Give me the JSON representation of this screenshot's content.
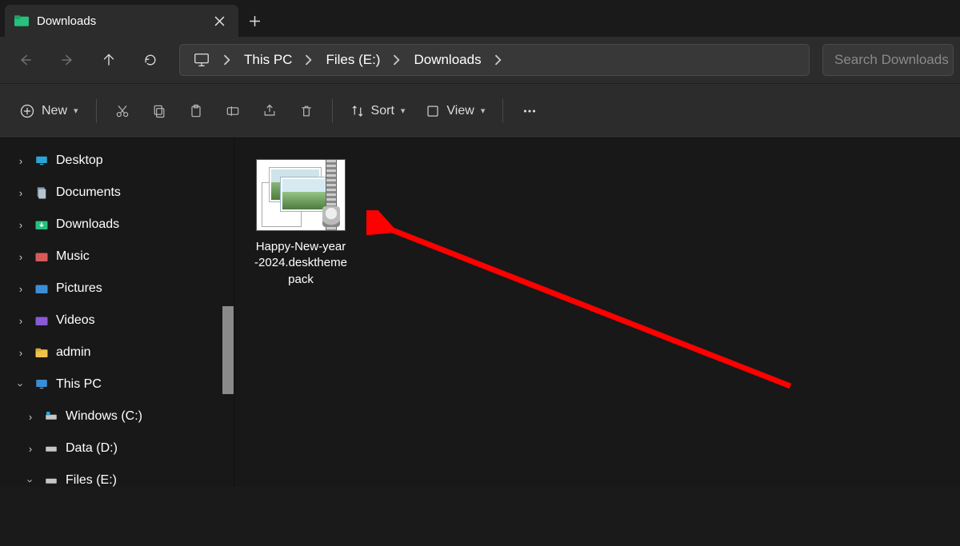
{
  "tab": {
    "title": "Downloads"
  },
  "breadcrumbs": {
    "pc": "This PC",
    "drive": "Files (E:)",
    "folder": "Downloads"
  },
  "search": {
    "placeholder": "Search Downloads"
  },
  "commands": {
    "new": "New",
    "sort": "Sort",
    "view": "View"
  },
  "sidebar": {
    "desktop": "Desktop",
    "documents": "Documents",
    "downloads": "Downloads",
    "music": "Music",
    "pictures": "Pictures",
    "videos": "Videos",
    "admin": "admin",
    "thispc": "This PC",
    "win_c": "Windows (C:)",
    "data_d": "Data (D:)",
    "files_e": "Files (E:)"
  },
  "files": [
    {
      "name_line1": "Happy-New-year",
      "name_line2": "-2024.desktheme",
      "name_line3": "pack"
    }
  ]
}
